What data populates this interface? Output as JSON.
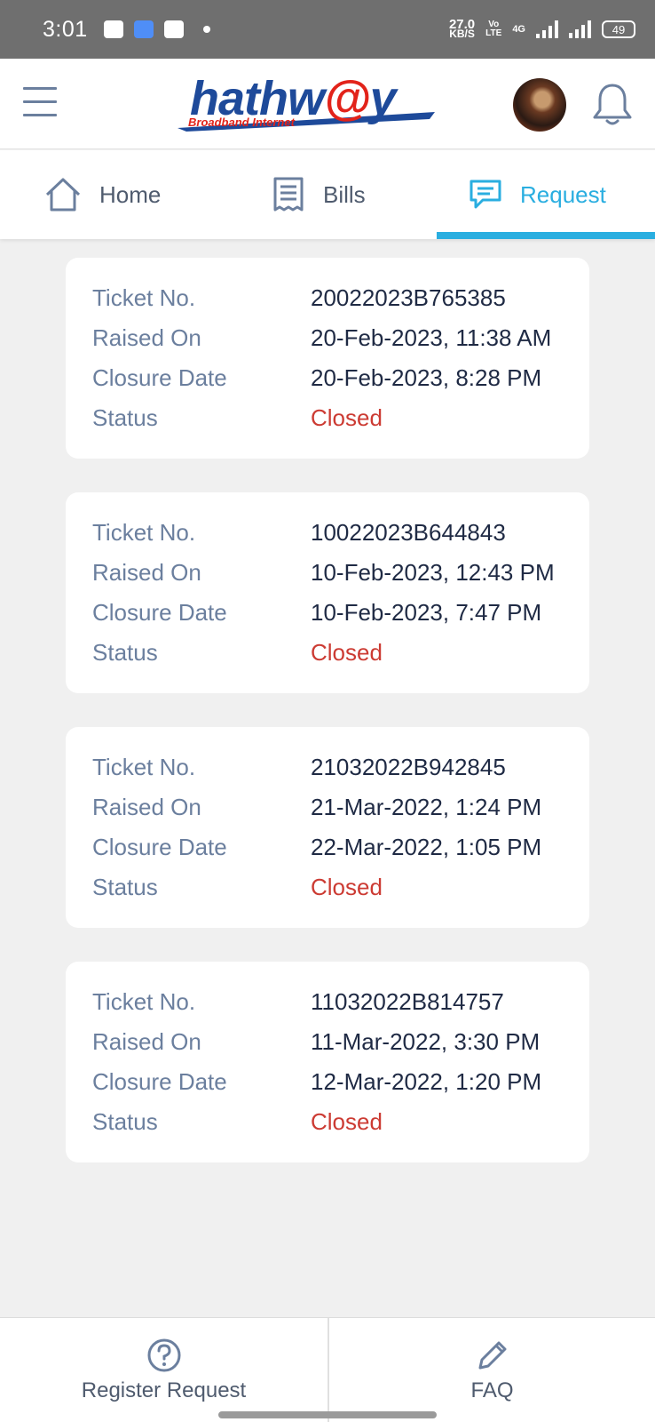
{
  "status_bar": {
    "time": "3:01",
    "net_speed": "27.0",
    "net_unit": "KB/S",
    "volte_top": "Vo",
    "volte_bottom": "LTE",
    "network": "4G",
    "battery": "49"
  },
  "header": {
    "logo_main_1": "hathw",
    "logo_at": "@",
    "logo_main_2": "y",
    "logo_sub": "Broadband Internet",
    "icons": [
      "menu-icon",
      "avatar",
      "bell-icon"
    ]
  },
  "tabs": [
    {
      "label": "Home",
      "icon": "home-icon",
      "active": false
    },
    {
      "label": "Bills",
      "icon": "receipt-icon",
      "active": false
    },
    {
      "label": "Request",
      "icon": "chat-icon",
      "active": true
    }
  ],
  "accent_color": "#2aaee0",
  "status_color": "#cc3b33",
  "tickets": [
    {
      "ticket_label": "Ticket No.",
      "ticket_no": "20022023B765385",
      "raised_label": "Raised On",
      "raised_on": "20-Feb-2023, 11:38 AM",
      "closure_label": "Closure Date",
      "closure_date": "20-Feb-2023, 8:28 PM",
      "status_label": "Status",
      "status": "Closed"
    },
    {
      "ticket_label": "Ticket No.",
      "ticket_no": "10022023B644843",
      "raised_label": "Raised On",
      "raised_on": "10-Feb-2023, 12:43 PM",
      "closure_label": "Closure Date",
      "closure_date": "10-Feb-2023, 7:47 PM",
      "status_label": "Status",
      "status": "Closed"
    },
    {
      "ticket_label": "Ticket No.",
      "ticket_no": "21032022B942845",
      "raised_label": "Raised On",
      "raised_on": "21-Mar-2022, 1:24 PM",
      "closure_label": "Closure Date",
      "closure_date": "22-Mar-2022, 1:05 PM",
      "status_label": "Status",
      "status": "Closed"
    },
    {
      "ticket_label": "Ticket No.",
      "ticket_no": "11032022B814757",
      "raised_label": "Raised On",
      "raised_on": "11-Mar-2022, 3:30 PM",
      "closure_label": "Closure Date",
      "closure_date": "12-Mar-2022, 1:20 PM",
      "status_label": "Status",
      "status": "Closed"
    }
  ],
  "bottom_bar": {
    "register_label": "Register Request",
    "register_icon": "question-circle-icon",
    "faq_label": "FAQ",
    "faq_icon": "pencil-icon"
  }
}
